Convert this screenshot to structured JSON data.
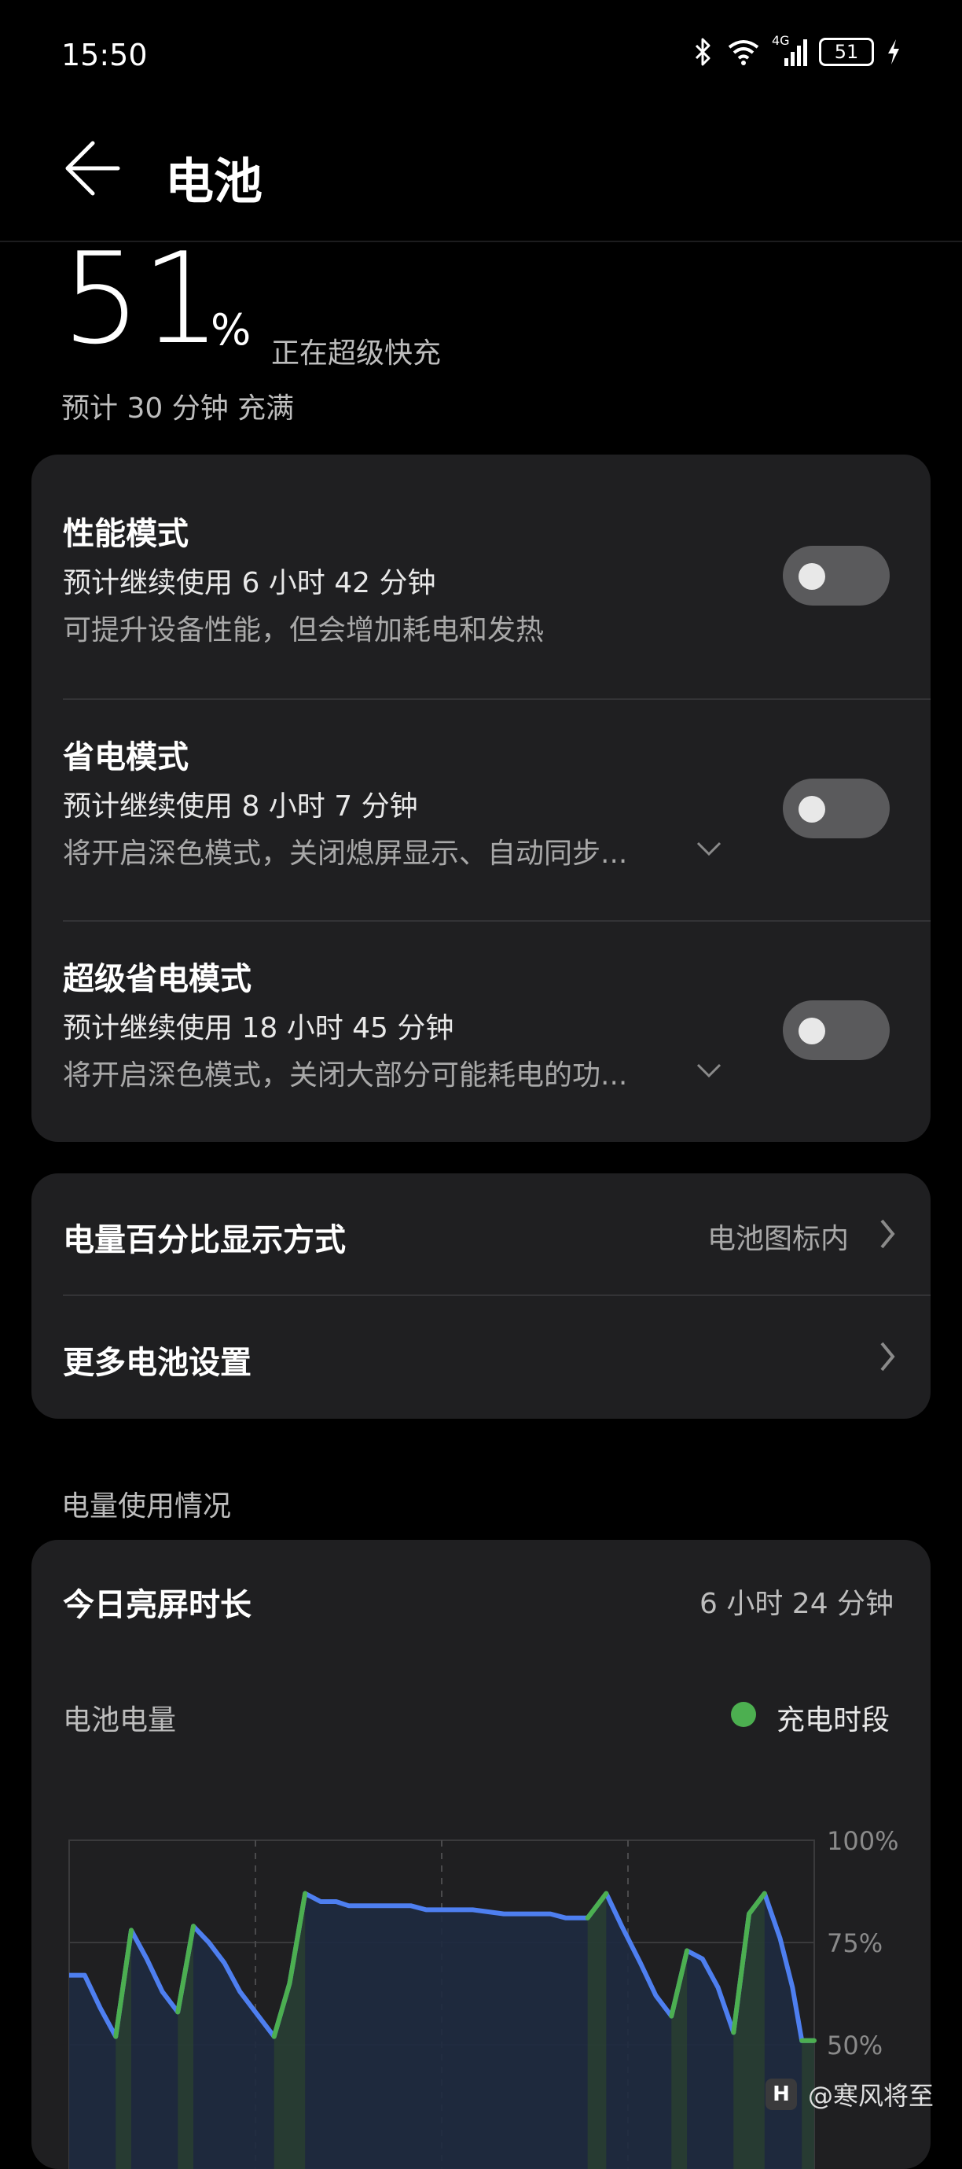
{
  "status_bar": {
    "time": "15:50",
    "network": "4G",
    "battery": "51"
  },
  "header": {
    "title": "电池"
  },
  "summary": {
    "percent": "51",
    "percent_sign": "%",
    "charge_state": "正在超级快充",
    "estimate": "预计 30 分钟 充满"
  },
  "modes": [
    {
      "title": "性能模式",
      "sub": "预计继续使用 6 小时 42 分钟",
      "desc": "可提升设备性能，但会增加耗电和发热",
      "enabled": false
    },
    {
      "title": "省电模式",
      "sub": "预计继续使用 8 小时 7 分钟",
      "desc": "将开启深色模式，关闭熄屏显示、自动同步...",
      "enabled": false
    },
    {
      "title": "超级省电模式",
      "sub": "预计继续使用 18 小时 45 分钟",
      "desc": "将开启深色模式，关闭大部分可能耗电的功...",
      "enabled": false
    }
  ],
  "settings": {
    "percent_display_label": "电量百分比显示方式",
    "percent_display_value": "电池图标内",
    "more_settings_label": "更多电池设置"
  },
  "usage": {
    "section_label": "电量使用情况",
    "screen_time_label": "今日亮屏时长",
    "screen_time_value": "6 小时 24 分钟",
    "battery_level_label": "电池电量",
    "legend_charging": "充电时段"
  },
  "colors": {
    "line": "#4e7ff0",
    "charging": "#4caf50",
    "card": "#1f1f21",
    "fill": "#1e2a40"
  },
  "chart_data": {
    "type": "line",
    "title": "电池电量",
    "y_ticks": [
      "100%",
      "75%",
      "50%"
    ],
    "ylim": [
      0,
      100
    ],
    "x_range": [
      0,
      24
    ],
    "x_gridlines": [
      6,
      12,
      18
    ],
    "grid": true,
    "series": [
      {
        "name": "充电时段",
        "segments": [
          {
            "x": [
              1.5,
              2.0
            ],
            "y": [
              52,
              78
            ]
          },
          {
            "x": [
              3.5,
              4.0
            ],
            "y": [
              58,
              79
            ]
          },
          {
            "x": [
              6.6,
              7.1,
              7.6
            ],
            "y": [
              52,
              65,
              87
            ]
          },
          {
            "x": [
              16.7,
              17.3
            ],
            "y": [
              81,
              87
            ]
          },
          {
            "x": [
              19.4,
              19.9
            ],
            "y": [
              57,
              73
            ]
          },
          {
            "x": [
              21.4,
              21.9,
              22.4
            ],
            "y": [
              53,
              82,
              87
            ]
          },
          {
            "x": [
              23.6,
              24.0
            ],
            "y": [
              51,
              51
            ]
          }
        ]
      }
    ],
    "level": {
      "x": [
        0,
        0.5,
        1.0,
        1.5,
        2.0,
        2.5,
        3.0,
        3.5,
        4.0,
        4.5,
        5.0,
        5.5,
        6.0,
        6.6,
        7.1,
        7.6,
        8.1,
        8.6,
        9.0,
        10.0,
        11.0,
        11.5,
        12.0,
        13.0,
        14.0,
        14.5,
        15.0,
        15.5,
        16.0,
        16.7,
        17.3,
        17.8,
        18.4,
        18.9,
        19.4,
        19.9,
        20.4,
        20.9,
        21.4,
        21.9,
        22.4,
        22.9,
        23.3,
        23.6,
        24.0
      ],
      "y": [
        67,
        67,
        59,
        52,
        78,
        71,
        63,
        58,
        79,
        75,
        70,
        63,
        58,
        52,
        65,
        87,
        85,
        85,
        84,
        84,
        84,
        83,
        83,
        83,
        82,
        82,
        82,
        82,
        81,
        81,
        87,
        79,
        70,
        62,
        57,
        73,
        71,
        64,
        53,
        82,
        87,
        76,
        64,
        51,
        51
      ]
    }
  }
}
